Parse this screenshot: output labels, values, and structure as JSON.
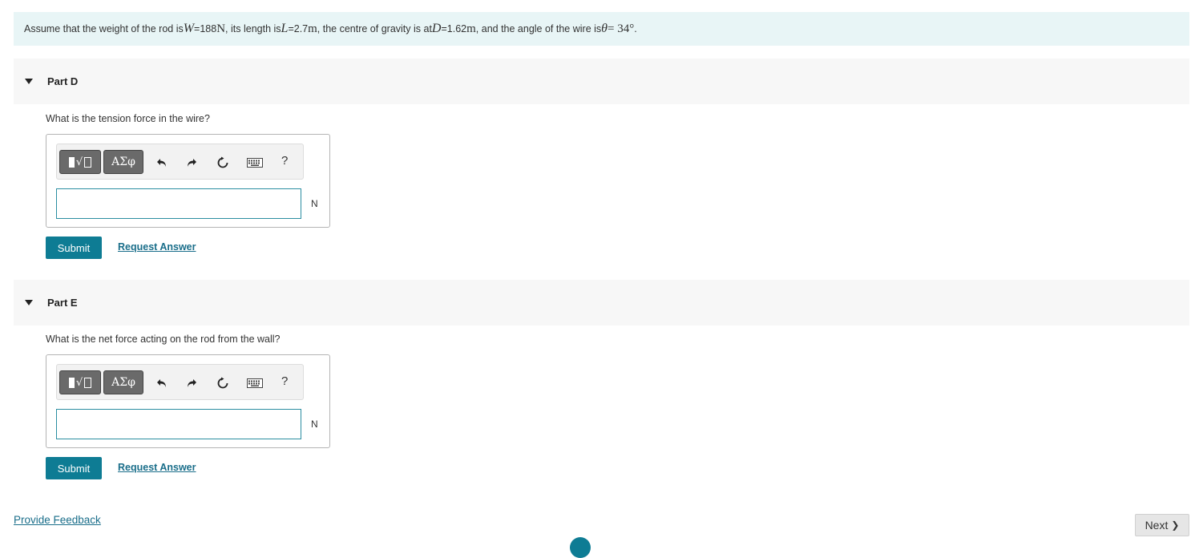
{
  "intro": {
    "t1": "Assume that the weight of the rod is ",
    "w_sym": "W",
    "t2": " =188 ",
    "w_unit": "N",
    "t3": " , its length is ",
    "l_sym": "L",
    "t4": " =2.7 ",
    "l_unit": "m",
    "t5": " , the centre of gravity is at ",
    "d_sym": "D",
    "t6": " =1.62 ",
    "d_unit": "m",
    "t7": " , and the angle of the wire is ",
    "theta_sym": "θ",
    "t8": " = 34°",
    "t9": "."
  },
  "parts": [
    {
      "title": "Part D",
      "question": "What is the tension force in the wire?",
      "unit": "N",
      "input_value": "",
      "submit_label": "Submit",
      "request_label": "Request Answer"
    },
    {
      "title": "Part E",
      "question": "What is the net force acting on the rod from the wall?",
      "unit": "N",
      "input_value": "",
      "submit_label": "Submit",
      "request_label": "Request Answer"
    }
  ],
  "toolbar": {
    "templates_radical": "√",
    "symbols_label": "ΑΣφ",
    "help_label": "?",
    "icons": [
      "templates-icon",
      "undo-icon",
      "redo-icon",
      "reset-icon",
      "keyboard-icon",
      "help-icon"
    ]
  },
  "footer": {
    "feedback_label": "Provide Feedback",
    "next_label": "Next",
    "next_chevron": "❯"
  },
  "colors": {
    "intro_bg": "#e8f5f6",
    "accent": "#0e7c94",
    "link": "#1a6e8a",
    "part_header_bg": "#f7f7f7"
  }
}
